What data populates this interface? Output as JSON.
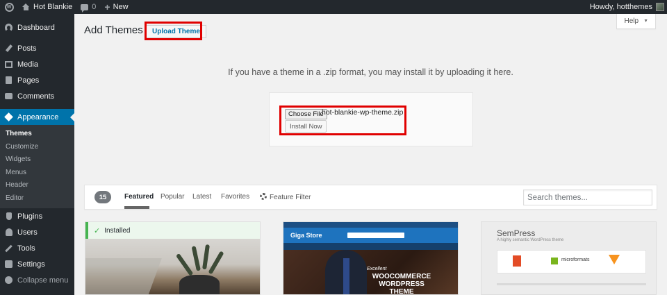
{
  "adminbar": {
    "site_name": "Hot Blankie",
    "comments_count": "0",
    "new_label": "New",
    "howdy": "Howdy, hotthemes"
  },
  "sidebar": {
    "items": [
      {
        "label": "Dashboard",
        "icon": "dashboard-icon"
      },
      {
        "label": "Posts",
        "icon": "pin-icon"
      },
      {
        "label": "Media",
        "icon": "media-icon"
      },
      {
        "label": "Pages",
        "icon": "page-icon"
      },
      {
        "label": "Comments",
        "icon": "comment-icon"
      },
      {
        "label": "Appearance",
        "icon": "brush-icon",
        "active": true
      },
      {
        "label": "Plugins",
        "icon": "plugin-icon"
      },
      {
        "label": "Users",
        "icon": "user-icon"
      },
      {
        "label": "Tools",
        "icon": "wrench-icon"
      },
      {
        "label": "Settings",
        "icon": "settings-icon"
      },
      {
        "label": "Collapse menu",
        "icon": "collapse-icon"
      }
    ],
    "appearance_submenu": [
      "Themes",
      "Customize",
      "Widgets",
      "Menus",
      "Header",
      "Editor"
    ]
  },
  "main": {
    "title": "Add Themes",
    "upload_button": "Upload Theme",
    "help_label": "Help",
    "upload_description": "If you have a theme in a .zip format, you may install it by uploading it here.",
    "choose_file_label": "Choose File",
    "file_name": "hot-blankie-wp-theme.zip",
    "install_label": "Install Now"
  },
  "filter": {
    "count": "15",
    "tabs": [
      "Featured",
      "Popular",
      "Latest",
      "Favorites"
    ],
    "feature_filter": "Feature Filter",
    "search_placeholder": "Search themes..."
  },
  "themes": {
    "installed_label": "Installed",
    "giga_title": "Giga Store",
    "giga_excellent": "Excellent",
    "giga_tagline": "WOOCOMMERCE WORDPRESS THEME",
    "sempress_title": "SemPress",
    "sempress_subtitle": "A highly semantic WordPress theme",
    "sempress_mf": "microformats"
  },
  "colors": {
    "admin_dark": "#23282d",
    "accent": "#0073aa",
    "highlight": "#e00000",
    "installed_green": "#46b450"
  }
}
